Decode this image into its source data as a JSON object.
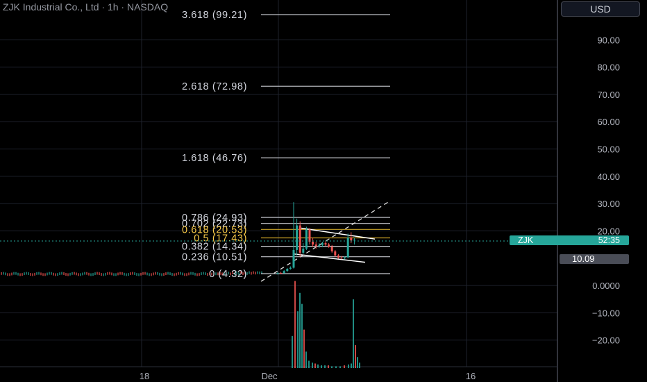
{
  "header": {
    "title": "ZJK Industrial Co., Ltd · 1h · NASDAQ",
    "currency_label": "USD"
  },
  "price_axis": {
    "ticks": [
      "90.00",
      "80.00",
      "70.00",
      "60.00",
      "50.00",
      "40.00",
      "30.00",
      "20.00",
      "0.0000",
      "−10.00",
      "−20.00"
    ]
  },
  "time_axis": {
    "ticks": [
      "18",
      "Dec",
      "16"
    ]
  },
  "symbol_badge": {
    "symbol": "ZJK",
    "countdown": "52:35",
    "price": "10.09"
  },
  "fib_levels": [
    {
      "label": "3.618 (99.21)",
      "color": "#d1d4dc"
    },
    {
      "label": "2.618 (72.98)",
      "color": "#d1d4dc"
    },
    {
      "label": "1.618 (46.76)",
      "color": "#d1d4dc"
    },
    {
      "label": "0.786 (24.93)",
      "color": "#d1d4dc"
    },
    {
      "label": "0.702 (22.73)",
      "color": "#d1d4dc"
    },
    {
      "label": "0.618 (20.53)",
      "color": "#f7c948"
    },
    {
      "label": "0.5 (17.43)",
      "color": "#f7c948"
    },
    {
      "label": "0.382 (14.34)",
      "color": "#d1d4dc"
    },
    {
      "label": "0.236 (10.51)",
      "color": "#d1d4dc"
    },
    {
      "label": "0 (4.32)",
      "color": "#d1d4dc"
    }
  ],
  "colors": {
    "up": "#26a69a",
    "down": "#ef5350",
    "grid": "#1e222d",
    "badge": "#26a69a",
    "price_badge": "#4a4d57",
    "fib_line": "#c8cacf"
  },
  "chart_data": {
    "type": "candlestick",
    "ylim": [
      -25,
      100
    ],
    "price_levels": [
      99.21,
      72.98,
      46.76,
      24.93,
      22.73,
      20.53,
      17.43,
      14.34,
      10.51,
      4.32
    ],
    "current_price": 10.09,
    "volume_spikes_in_pane": [
      0,
      -10,
      -20
    ],
    "channel": {
      "upper_start": 21.0,
      "upper_end": 17.0,
      "lower_start": 11.5,
      "lower_end": 8.5
    },
    "trend_line": {
      "start": 4.3,
      "end": 31.0
    },
    "candles": [
      {
        "o": 4.4,
        "h": 4.8,
        "l": 4.0,
        "c": 4.6
      },
      {
        "o": 4.6,
        "h": 5.0,
        "l": 4.3,
        "c": 4.5
      },
      {
        "o": 4.5,
        "h": 5.6,
        "l": 4.4,
        "c": 5.3
      },
      {
        "o": 5.3,
        "h": 6.4,
        "l": 5.0,
        "c": 6.1
      },
      {
        "o": 6.1,
        "h": 7.0,
        "l": 5.8,
        "c": 6.5
      },
      {
        "o": 6.5,
        "h": 30.5,
        "l": 6.2,
        "c": 13.0
      },
      {
        "o": 13.0,
        "h": 24.5,
        "l": 11.0,
        "c": 22.0
      },
      {
        "o": 22.0,
        "h": 23.5,
        "l": 10.5,
        "c": 12.0
      },
      {
        "o": 12.0,
        "h": 15.5,
        "l": 11.5,
        "c": 13.5
      },
      {
        "o": 13.5,
        "h": 21.5,
        "l": 13.0,
        "c": 20.5
      },
      {
        "o": 20.5,
        "h": 21.0,
        "l": 15.0,
        "c": 16.0
      },
      {
        "o": 16.0,
        "h": 17.5,
        "l": 14.0,
        "c": 15.0
      },
      {
        "o": 15.0,
        "h": 16.0,
        "l": 13.5,
        "c": 14.5
      },
      {
        "o": 14.5,
        "h": 15.5,
        "l": 13.8,
        "c": 14.8
      },
      {
        "o": 14.8,
        "h": 16.0,
        "l": 14.0,
        "c": 15.5
      },
      {
        "o": 15.5,
        "h": 16.2,
        "l": 14.5,
        "c": 15.0
      },
      {
        "o": 15.0,
        "h": 15.5,
        "l": 13.8,
        "c": 14.2
      },
      {
        "o": 14.2,
        "h": 14.8,
        "l": 12.0,
        "c": 12.5
      },
      {
        "o": 12.5,
        "h": 13.0,
        "l": 10.5,
        "c": 11.0
      },
      {
        "o": 11.0,
        "h": 11.5,
        "l": 9.8,
        "c": 10.2
      },
      {
        "o": 10.2,
        "h": 10.8,
        "l": 9.6,
        "c": 10.0
      },
      {
        "o": 10.0,
        "h": 10.6,
        "l": 9.5,
        "c": 10.3
      },
      {
        "o": 10.3,
        "h": 19.0,
        "l": 10.0,
        "c": 17.5
      },
      {
        "o": 17.5,
        "h": 19.5,
        "l": 15.5,
        "c": 16.5
      },
      {
        "o": 16.5,
        "h": 17.5,
        "l": 15.0,
        "c": 16.8
      }
    ]
  }
}
